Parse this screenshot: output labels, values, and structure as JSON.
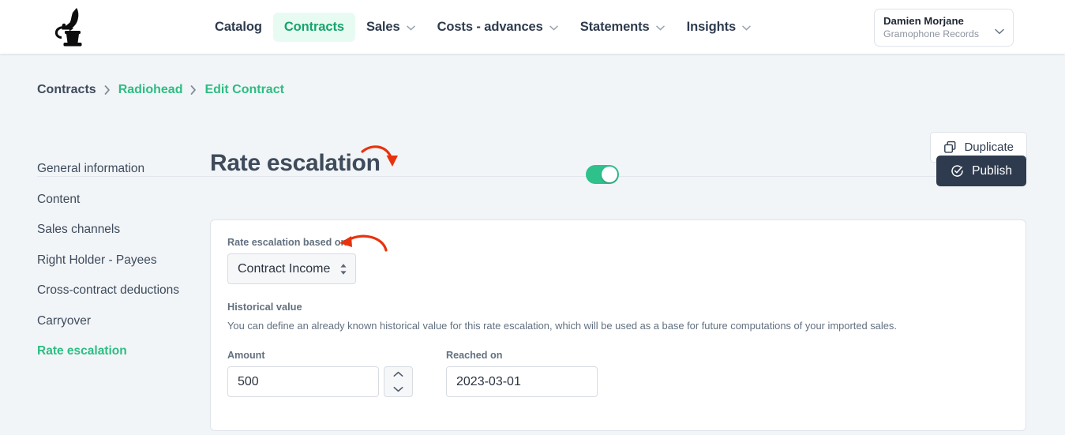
{
  "navbar": {
    "logo_icon": "gramophone-logo",
    "items": [
      {
        "label": "Catalog",
        "has_dropdown": false,
        "active": false
      },
      {
        "label": "Contracts",
        "has_dropdown": false,
        "active": true
      },
      {
        "label": "Sales",
        "has_dropdown": true,
        "active": false
      },
      {
        "label": "Costs - advances",
        "has_dropdown": true,
        "active": false
      },
      {
        "label": "Statements",
        "has_dropdown": true,
        "active": false
      },
      {
        "label": "Insights",
        "has_dropdown": true,
        "active": false
      }
    ],
    "user": {
      "name": "Damien Morjane",
      "organization": "Gramophone Records",
      "chevron_icon": "chevron-down-icon"
    }
  },
  "breadcrumb": {
    "items": [
      {
        "label": "Contracts",
        "style": "dark"
      },
      {
        "label": "Radiohead",
        "style": "green"
      },
      {
        "label": "Edit Contract",
        "style": "green"
      }
    ],
    "separator_icon": "chevron-right-icon"
  },
  "toolbar": {
    "duplicate_label": "Duplicate",
    "duplicate_icon": "copy-icon"
  },
  "sidebar": {
    "items": [
      {
        "label": "General information",
        "active": false
      },
      {
        "label": "Content",
        "active": false
      },
      {
        "label": "Sales channels",
        "active": false
      },
      {
        "label": "Right Holder - Payees",
        "active": false
      },
      {
        "label": "Cross-contract deductions",
        "active": false
      },
      {
        "label": "Carryover",
        "active": false
      },
      {
        "label": "Rate escalation",
        "active": true
      }
    ]
  },
  "main": {
    "title": "Rate escalation",
    "toggle": {
      "state": "on",
      "name": "rate-escalation-toggle"
    },
    "publish_label": "Publish",
    "publish_icon": "check-circle-icon",
    "based_on": {
      "label": "Rate escalation based on",
      "value": "Contract Income",
      "icon": "up-down-arrows-icon"
    },
    "historical": {
      "title": "Historical value",
      "description": "You can define an already known historical value for this rate escalation, which will be used as a base for future computations of your imported sales."
    },
    "amount": {
      "label": "Amount",
      "value": "500",
      "stepper_up_icon": "chevron-up-icon",
      "stepper_down_icon": "chevron-down-icon"
    },
    "reached_on": {
      "label": "Reached on",
      "value": "2023-03-01"
    }
  },
  "annotations": {
    "arrow_color": "#e8320e",
    "arrows": [
      {
        "name": "arrow-to-toggle",
        "target": "rate-escalation-toggle"
      },
      {
        "name": "arrow-to-based-on-select",
        "target": "based-on-select"
      }
    ]
  },
  "colors": {
    "page_background": "#f2f5f8",
    "accent_green": "#2dbd82",
    "toggle_green": "#2fc18c",
    "nav_active_bg": "#e8fbf2",
    "dark_navy": "#2e3b4e",
    "annotation_red": "#e8320e"
  }
}
